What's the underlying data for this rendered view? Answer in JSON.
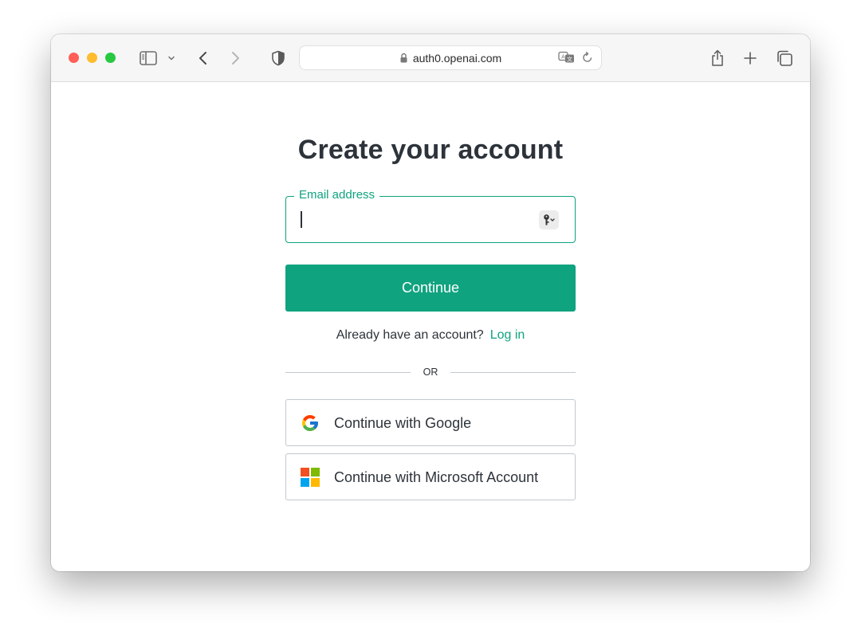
{
  "browser": {
    "url": "auth0.openai.com"
  },
  "page": {
    "title": "Create your account",
    "email": {
      "label": "Email address",
      "value": "",
      "placeholder": ""
    },
    "continue_label": "Continue",
    "login_prompt": "Already have an account?",
    "login_link": "Log in",
    "divider_text": "OR",
    "google_label": "Continue with Google",
    "microsoft_label": "Continue with Microsoft Account"
  },
  "colors": {
    "accent": "#10a37f",
    "title": "#2d333a",
    "traffic_red": "#ff5f57",
    "traffic_yellow": "#febc2e",
    "traffic_green": "#28c840"
  },
  "icons": {
    "browser": [
      "sidebar-icon",
      "chevron-down-icon",
      "back-icon",
      "forward-icon",
      "shield-icon",
      "lock-icon",
      "translate-icon",
      "reload-icon",
      "share-icon",
      "new-tab-icon",
      "tabs-overview-icon"
    ],
    "page": [
      "key-icon",
      "google-logo-icon",
      "microsoft-logo-icon"
    ]
  }
}
